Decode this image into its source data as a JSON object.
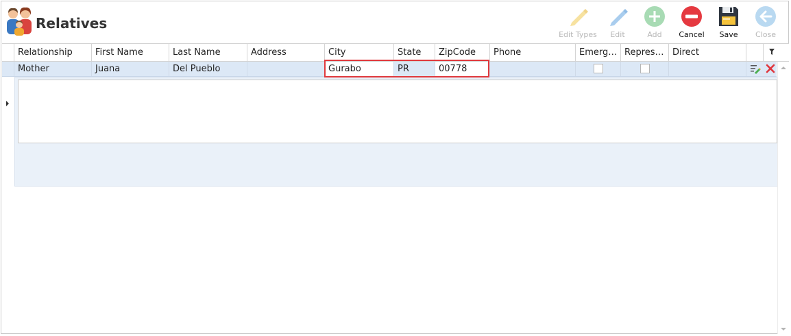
{
  "header": {
    "title": "Relatives",
    "icon": "family-icon"
  },
  "toolbar": {
    "edit_types": "Edit Types",
    "edit": "Edit",
    "add": "Add",
    "cancel": "Cancel",
    "save": "Save",
    "close": "Close"
  },
  "grid": {
    "columns": [
      "Relationship",
      "First Name",
      "Last Name",
      "Address",
      "City",
      "State",
      "ZipCode",
      "Phone",
      "Emerge...",
      "Represe...",
      "Direct"
    ],
    "row": {
      "relationship": "Mother",
      "first_name": "Juana",
      "last_name": "Del Pueblo",
      "address": "",
      "city": "Gurabo",
      "state": "PR",
      "zipcode": "00778",
      "phone": "",
      "emergency": false,
      "representative": false,
      "direct": ""
    }
  },
  "colors": {
    "selected_row": "#dce8f6",
    "highlight": "#e0393d",
    "cancel_red": "#e53940",
    "delete_red": "#e0353b"
  }
}
